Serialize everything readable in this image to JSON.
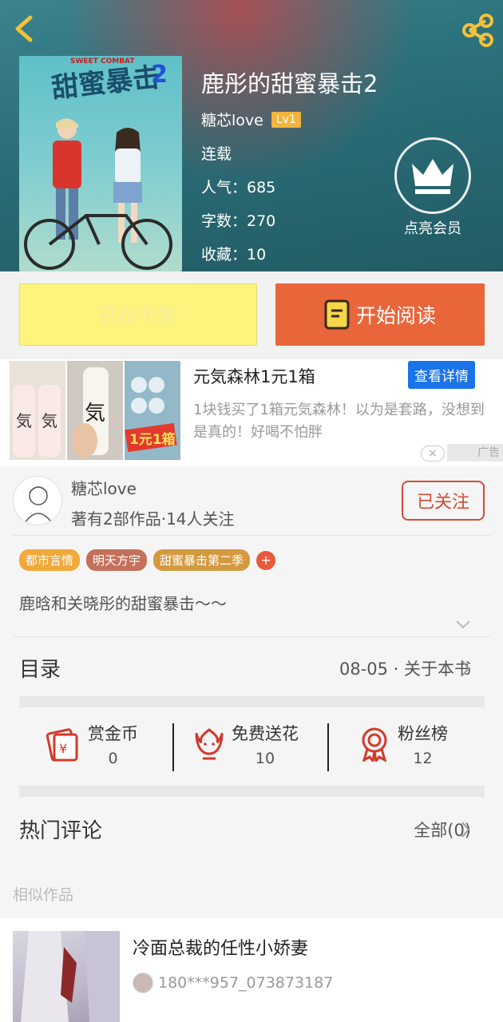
{
  "book": {
    "title": "鹿彤的甜蜜暴击2",
    "author": "糖芯love",
    "level": "Lv1",
    "status": "连载",
    "popularity": "人气：685",
    "words": "字数：270",
    "favorites": "收藏：10",
    "cover_title": "甜蜜暴击",
    "cover_number": "2",
    "cover_subtitle": "SWEET COMBAT"
  },
  "vip": {
    "label": "点亮会员"
  },
  "actions": {
    "shelf_label": "已在书架",
    "read_label": "开始阅读"
  },
  "ad": {
    "title": "元気森林1元1箱",
    "detail_label": "查看详情",
    "description": "1块钱买了1箱元気森林！以为是套路，没想到是真的！好喝不怕胖",
    "tag": "广告",
    "close": "×",
    "promo": "1元1箱"
  },
  "author_card": {
    "name": "糖芯love",
    "stats": "著有2部作品·14人关注",
    "follow_label": "已关注"
  },
  "tags": [
    {
      "label": "都市言情",
      "color": "#f1a93a"
    },
    {
      "label": "明天方宇",
      "color": "#c4705a"
    },
    {
      "label": "甜蜜暴击第二季",
      "color": "#d49a40"
    }
  ],
  "tag_more": "+",
  "intro": "鹿晗和关晓彤的甜蜜暴击～～",
  "toc": {
    "label": "目录",
    "right": "08-05 · 关于本书"
  },
  "stats": [
    {
      "title": "赏金币",
      "value": "0"
    },
    {
      "title": "免费送花",
      "value": "10"
    },
    {
      "title": "粉丝榜",
      "value": "12"
    }
  ],
  "comments": {
    "label": "热门评论",
    "right": "全部(0)"
  },
  "similar": {
    "section_label": "相似作品",
    "items": [
      {
        "title": "冷面总裁的任性小娇妻",
        "author": "180***957_073873187"
      }
    ]
  },
  "colors": {
    "accent": "#e9653a",
    "shelf": "#fdf47e",
    "follow": "#d24b35",
    "link_blue": "#1a73e8"
  }
}
